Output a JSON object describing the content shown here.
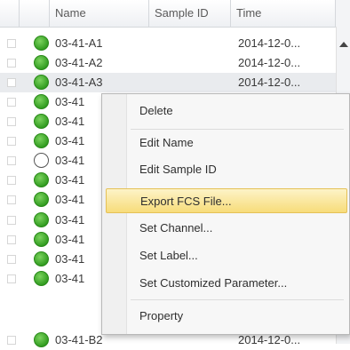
{
  "table": {
    "columns": [
      "Name",
      "Sample ID",
      "Time"
    ],
    "rows": [
      {
        "name": "03-41-A1",
        "sample_id": "",
        "time": "2014-12-0...",
        "status": "green"
      },
      {
        "name": "03-41-A2",
        "sample_id": "",
        "time": "2014-12-0...",
        "status": "green"
      },
      {
        "name": "03-41-A3",
        "sample_id": "",
        "time": "2014-12-0...",
        "status": "green"
      },
      {
        "name": "03-41",
        "sample_id": "",
        "time": "",
        "status": "green"
      },
      {
        "name": "03-41",
        "sample_id": "",
        "time": "",
        "status": "green"
      },
      {
        "name": "03-41",
        "sample_id": "",
        "time": "",
        "status": "green"
      },
      {
        "name": "03-41",
        "sample_id": "",
        "time": "",
        "status": "empty"
      },
      {
        "name": "03-41",
        "sample_id": "",
        "time": "",
        "status": "green"
      },
      {
        "name": "03-41",
        "sample_id": "",
        "time": "",
        "status": "green"
      },
      {
        "name": "03-41",
        "sample_id": "",
        "time": "",
        "status": "green"
      },
      {
        "name": "03-41",
        "sample_id": "",
        "time": "",
        "status": "green"
      },
      {
        "name": "03-41",
        "sample_id": "",
        "time": "",
        "status": "green"
      },
      {
        "name": "03-41",
        "sample_id": "",
        "time": "",
        "status": "green"
      },
      {
        "name": "03-41-B2",
        "sample_id": "",
        "time": "2014-12-0...",
        "status": "green"
      }
    ]
  },
  "context_menu": {
    "items": [
      "Delete",
      "Edit Name",
      "Edit Sample ID",
      "Export FCS File...",
      "Set Channel...",
      "Set Label...",
      "Set Customized Parameter...",
      "Property"
    ],
    "highlighted": "Export FCS File..."
  },
  "colors": {
    "status_green": "#3aa629",
    "highlight": "#f7dc7a"
  },
  "icons": {
    "scroll_up": "scroll-up-arrow-icon",
    "status": "status-dot-icon"
  }
}
